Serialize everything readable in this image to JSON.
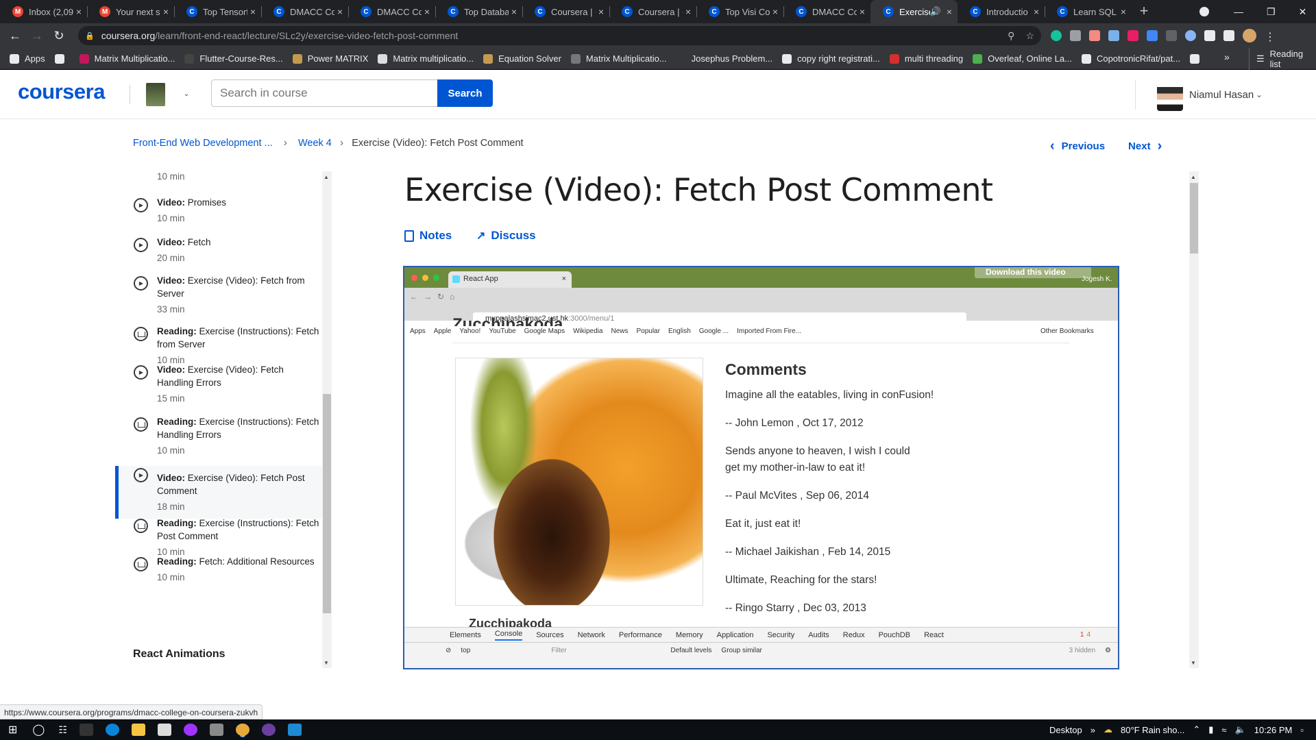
{
  "browser": {
    "tabs": [
      {
        "title": "Inbox (2,09",
        "icon": "gmail-icon",
        "color": "#ea4335",
        "letter": "M"
      },
      {
        "title": "Your next st",
        "icon": "gmail-icon",
        "color": "#ea4335",
        "letter": "M"
      },
      {
        "title": "Top Tensorf",
        "icon": "coursera-icon",
        "color": "#0056d2",
        "letter": "C"
      },
      {
        "title": "DMACC Co",
        "icon": "coursera-icon",
        "color": "#0056d2",
        "letter": "C"
      },
      {
        "title": "DMACC Co",
        "icon": "coursera-icon",
        "color": "#0056d2",
        "letter": "C"
      },
      {
        "title": "Top Databa",
        "icon": "coursera-icon",
        "color": "#0056d2",
        "letter": "C"
      },
      {
        "title": "Coursera | C",
        "icon": "coursera-icon",
        "color": "#0056d2",
        "letter": "C"
      },
      {
        "title": "Coursera | C",
        "icon": "coursera-icon",
        "color": "#0056d2",
        "letter": "C"
      },
      {
        "title": "Top Visi Co",
        "icon": "coursera-icon",
        "color": "#0056d2",
        "letter": "C"
      },
      {
        "title": "DMACC Co",
        "icon": "coursera-icon",
        "color": "#0056d2",
        "letter": "C"
      },
      {
        "title": "Exercise",
        "icon": "coursera-icon",
        "color": "#0056d2",
        "letter": "C",
        "active": true
      },
      {
        "title": "Introductio",
        "icon": "coursera-icon",
        "color": "#0056d2",
        "letter": "C"
      },
      {
        "title": "Learn SQL",
        "icon": "coursera-icon",
        "color": "#0056d2",
        "letter": "C"
      }
    ],
    "new_tab": "+",
    "close": "×",
    "url_domain": "coursera.org",
    "url_path": "/learn/front-end-react/lecture/SLc2y/exercise-video-fetch-post-comment",
    "bookmarks": [
      {
        "label": "Apps",
        "color": "#e8eaed"
      },
      {
        "label": "",
        "color": "#e8eaed"
      },
      {
        "label": "Matrix Multiplicatio...",
        "color": "#c2185b"
      },
      {
        "label": "Flutter-Course-Res...",
        "color": "#444"
      },
      {
        "label": "Power MATRIX",
        "color": "#c49a50"
      },
      {
        "label": "Matrix multiplicatio...",
        "color": "#ddd"
      },
      {
        "label": "Equation Solver",
        "color": "#c49a50"
      },
      {
        "label": "Matrix Multiplicatio...",
        "color": "#777"
      },
      {
        "label": "Josephus Problem...",
        "color": "#35363a"
      },
      {
        "label": "copy right registrati...",
        "color": "#e8eaed"
      },
      {
        "label": "multi threading",
        "color": "#d32f2f"
      },
      {
        "label": "Overleaf, Online La...",
        "color": "#4caf50"
      },
      {
        "label": "CopotronicRifat/pat...",
        "color": "#e8eaed"
      },
      {
        "label": "",
        "color": "#e8eaed"
      }
    ],
    "more_bookmarks": "»",
    "reading_list": "Reading list"
  },
  "header": {
    "logo": "coursera",
    "search_placeholder": "Search in course",
    "search_button": "Search",
    "user_name": "Niamul Hasan"
  },
  "breadcrumb": {
    "course": "Front-End Web Development ...",
    "week": "Week 4",
    "current": "Exercise (Video): Fetch Post Comment"
  },
  "nav": {
    "previous": "Previous",
    "next": "Next"
  },
  "sidebar": {
    "partial_duration": "10 min",
    "items": [
      {
        "kind": "Video:",
        "title": "Promises",
        "duration": "10 min",
        "type": "video"
      },
      {
        "kind": "Video:",
        "title": "Fetch",
        "duration": "20 min",
        "type": "video"
      },
      {
        "kind": "Video:",
        "title": "Exercise (Video): Fetch from Server",
        "duration": "33 min",
        "type": "video"
      },
      {
        "kind": "Reading:",
        "title": "Exercise (Instructions): Fetch from Server",
        "duration": "10 min",
        "type": "reading"
      },
      {
        "kind": "Video:",
        "title": "Exercise (Video): Fetch Handling Errors",
        "duration": "15 min",
        "type": "video"
      },
      {
        "kind": "Reading:",
        "title": "Exercise (Instructions): Fetch Handling Errors",
        "duration": "10 min",
        "type": "reading"
      },
      {
        "kind": "Video:",
        "title": "Exercise (Video): Fetch Post Comment",
        "duration": "18 min",
        "type": "video",
        "active": true
      },
      {
        "kind": "Reading:",
        "title": "Exercise (Instructions): Fetch Post Comment",
        "duration": "10 min",
        "type": "reading"
      },
      {
        "kind": "Reading:",
        "title": "Fetch: Additional Resources",
        "duration": "10 min",
        "type": "reading"
      }
    ],
    "section": "React Animations"
  },
  "lesson": {
    "title": "Exercise (Video): Fetch Post Comment",
    "notes": "Notes",
    "discuss": "Discuss"
  },
  "video": {
    "tab_title": "React App",
    "download": "Download this video",
    "watermark": "Jogesh K.",
    "url": "muppalashsimac2.ust.hk",
    "url_path": ":3000/menu/1",
    "bookmarks": [
      "Apps",
      "Apple",
      "Yahoo!",
      "YouTube",
      "Google Maps",
      "Wikipedia",
      "News",
      "Popular",
      "English",
      "Google ...",
      "Imported From Fire..."
    ],
    "other_bookmarks": "Other Bookmarks",
    "dish_heading": "Zucchipakoda",
    "dish_name": "Zucchipakoda",
    "comments_heading": "Comments",
    "comments": [
      "Imagine all the eatables, living in conFusion!",
      "-- John Lemon , Oct 17, 2012",
      "Sends anyone to heaven, I wish I could get my mother-in-law to eat it!",
      "-- Paul McVites , Sep 06, 2014",
      "Eat it, just eat it!",
      "-- Michael Jaikishan , Feb 14, 2015",
      "Ultimate, Reaching for the stars!",
      "-- Ringo Starry , Dec 03, 2013"
    ],
    "devtools_tabs": [
      "Elements",
      "Console",
      "Sources",
      "Network",
      "Performance",
      "Memory",
      "Application",
      "Security",
      "Audits",
      "Redux",
      "PouchDB",
      "React"
    ],
    "devtools_active": "Console",
    "devtools_context": "top",
    "devtools_filter": "Filter",
    "devtools_levels": "Default levels",
    "devtools_group": "Group similar",
    "devtools_hidden": "3 hidden",
    "devtools_errors": "1",
    "devtools_warnings": "4"
  },
  "status_url": "https://www.coursera.org/programs/dmacc-college-on-coursera-zukvh",
  "taskbar": {
    "desktop": "Desktop",
    "weather": "80°F  Rain sho...",
    "time": "10:26 PM"
  }
}
